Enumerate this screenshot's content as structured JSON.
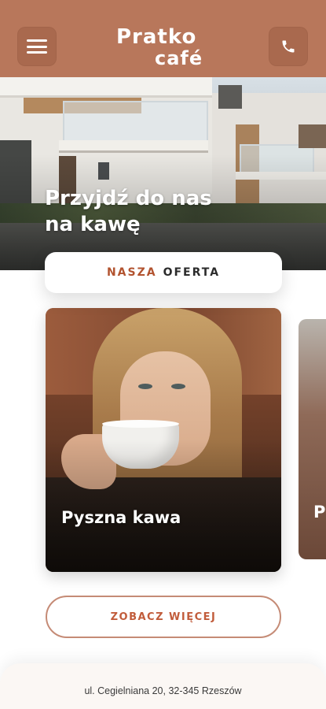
{
  "header": {
    "logo_line1": "Pratko",
    "logo_line2": "café",
    "menu_icon": "hamburger-menu-icon",
    "phone_icon": "phone-icon",
    "background_color": "#b8775b"
  },
  "hero": {
    "title_line1": "Przyjdź do nas",
    "title_line2": "na kawę"
  },
  "offer": {
    "accent_word": "NASZA",
    "rest_word": "OFERTA",
    "accent_color": "#b2532f"
  },
  "slider": {
    "cards": [
      {
        "title": "Pyszna kawa"
      },
      {
        "title": "P"
      }
    ]
  },
  "cta": {
    "label": "ZOBACZ WIĘCEJ"
  },
  "footer": {
    "address": "ul. Cegielniana 20, 32-345 Rzeszów"
  }
}
